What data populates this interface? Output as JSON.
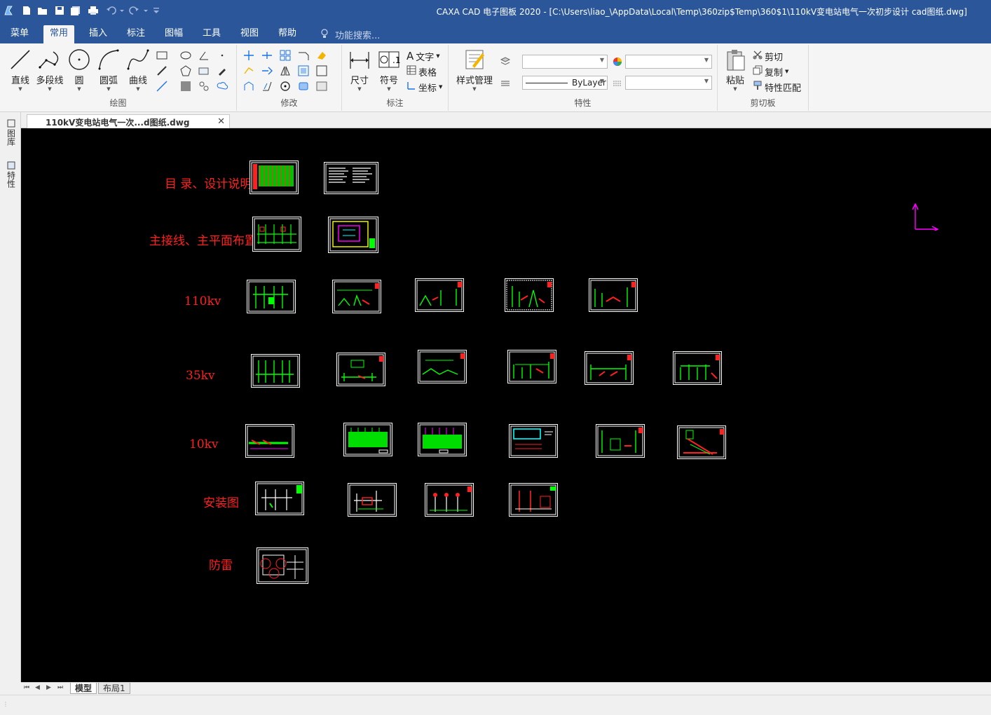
{
  "window": {
    "title": "CAXA CAD 电子图板 2020 - [C:\\Users\\liao_\\AppData\\Local\\Temp\\360zip$Temp\\360$1\\110kV变电站电气一次初步设计 cad图纸.dwg]"
  },
  "menu_tabs": [
    "菜单",
    "常用",
    "插入",
    "标注",
    "图幅",
    "工具",
    "视图",
    "帮助"
  ],
  "search_placeholder": "功能搜索...",
  "ribbon": {
    "draw": {
      "label": "绘图",
      "buttons": [
        "直线",
        "多段线",
        "圆",
        "圆弧",
        "曲线"
      ]
    },
    "modify": {
      "label": "修改"
    },
    "annotate": {
      "label": "标注",
      "buttons": [
        "尺寸",
        "符号"
      ],
      "small": [
        "文字",
        "表格",
        "坐标"
      ]
    },
    "properties": {
      "label": "特性",
      "style_button": "样式管理",
      "linetype_value": "ByLayer"
    },
    "clipboard": {
      "label": "剪切板",
      "paste": "粘贴",
      "small": [
        "剪切",
        "复制",
        "特性匹配"
      ]
    }
  },
  "document_tab": "110kV变电站电气一次...d图纸.dwg",
  "side_tabs": [
    "图库",
    "特性"
  ],
  "canvas_rows": [
    "目 录、设计说明",
    "主接线、主平面布置",
    "110kv",
    "35kv",
    "10kv",
    "安装图",
    "防雷"
  ],
  "layout_tabs": [
    "模型",
    "布局1"
  ],
  "colors": {
    "titlebar": "#2b579a",
    "canvas": "#000000",
    "row_label": "#ff2020",
    "drawing_green": "#00ff00",
    "ucs": "#ff00ff"
  }
}
